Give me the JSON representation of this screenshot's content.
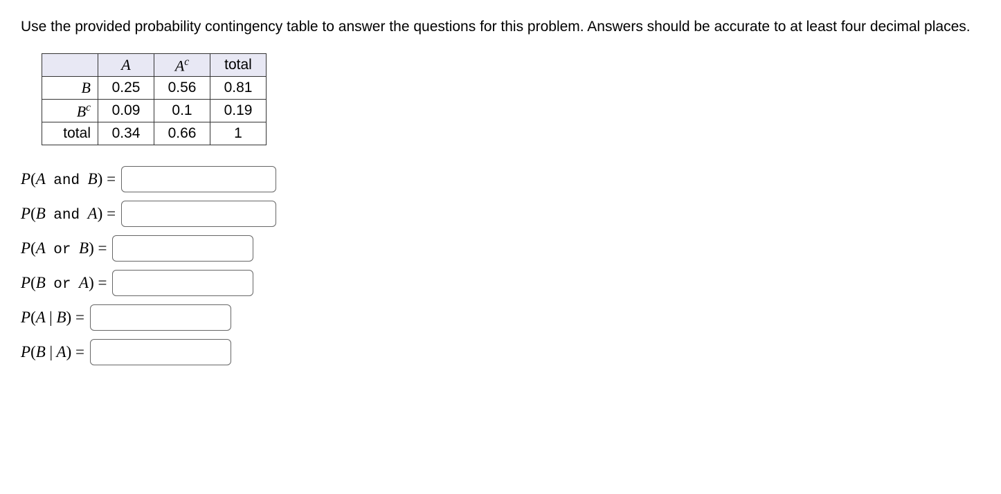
{
  "instruction": "Use the provided probability contingency table to answer the questions for this problem. Answers should be accurate to at least four decimal places.",
  "table": {
    "col_headers": {
      "blank": "",
      "A": "A",
      "Ac": "A",
      "Ac_sup": "c",
      "total": "total"
    },
    "rows": [
      {
        "label": "B",
        "sup": "",
        "A": "0.25",
        "Ac": "0.56",
        "total": "0.81"
      },
      {
        "label": "B",
        "sup": "c",
        "A": "0.09",
        "Ac": "0.1",
        "total": "0.19"
      },
      {
        "label": "total",
        "sup": "",
        "A": "0.34",
        "Ac": "0.66",
        "total": "1"
      }
    ]
  },
  "questions": [
    {
      "label_pre": "P",
      "inner_left": "A",
      "op": "and",
      "inner_right": "B",
      "eq": "="
    },
    {
      "label_pre": "P",
      "inner_left": "B",
      "op": "and",
      "inner_right": "A",
      "eq": "="
    },
    {
      "label_pre": "P",
      "inner_left": "A",
      "op": "or",
      "inner_right": "B",
      "eq": "="
    },
    {
      "label_pre": "P",
      "inner_left": "B",
      "op": "or",
      "inner_right": "A",
      "eq": "="
    },
    {
      "label_pre": "P",
      "inner_left": "A",
      "op": "|",
      "inner_right": "B",
      "eq": "="
    },
    {
      "label_pre": "P",
      "inner_left": "B",
      "op": "|",
      "inner_right": "A",
      "eq": "="
    }
  ]
}
